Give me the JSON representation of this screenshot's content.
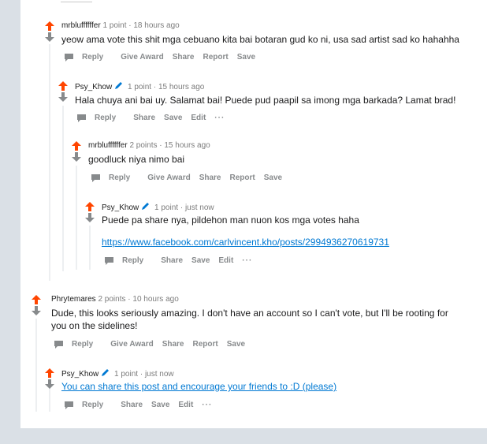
{
  "icons": {
    "upvote": "upvote-arrow-icon",
    "downvote": "downvote-arrow-icon",
    "reply": "chat-bubble-icon",
    "mod": "pencil-icon",
    "more": "more-dots-icon"
  },
  "colors": {
    "upvote": "#ff4500",
    "downvote": "#878a8c",
    "link": "#0079d3",
    "pencil": "#0079d3"
  },
  "comments": [
    {
      "author": "mrbluffffffer",
      "meta": "1 point · 18 hours ago",
      "body": "yeow ama vote this shit mga cebuano kita bai botaran gud ko ni, usa sad artist sad ko hahahha",
      "actions": [
        "Reply",
        "Give Award",
        "Share",
        "Report",
        "Save"
      ]
    },
    {
      "author": "Psy_Khow",
      "meta": "1 point · 15 hours ago",
      "body": "Hala chuya ani bai uy. Salamat bai! Puede pud paapil sa imong mga barkada? Lamat brad!",
      "actions": [
        "Reply",
        "Share",
        "Save",
        "Edit",
        "···"
      ]
    },
    {
      "author": "mrbluffffffer",
      "meta": "2 points · 15 hours ago",
      "body": "goodluck niya nimo bai",
      "actions": [
        "Reply",
        "Give Award",
        "Share",
        "Report",
        "Save"
      ]
    },
    {
      "author": "Psy_Khow",
      "meta": "1 point · just now",
      "body": "Puede pa share nya, pildehon man nuon kos mga votes haha",
      "link": "https://www.facebook.com/carlvincent.kho/posts/2994936270619731",
      "actions": [
        "Reply",
        "Share",
        "Save",
        "Edit",
        "···"
      ]
    },
    {
      "author": "Phrytemares",
      "meta": "2 points · 10 hours ago",
      "body": "Dude, this looks seriously amazing. I don't have an account so I can't vote, but I'll be rooting for you on the sidelines!",
      "actions": [
        "Reply",
        "Give Award",
        "Share",
        "Report",
        "Save"
      ]
    },
    {
      "author": "Psy_Khow",
      "meta": "1 point · just now",
      "link": "You can share this post and encourage your friends to :D (please)",
      "actions": [
        "Reply",
        "Share",
        "Save",
        "Edit",
        "···"
      ]
    }
  ]
}
